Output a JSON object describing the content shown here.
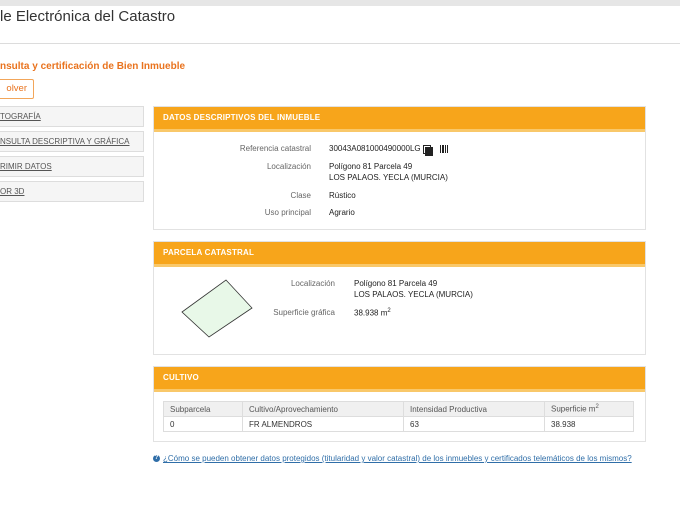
{
  "header": {
    "title": "le Electrónica del Catastro"
  },
  "page": {
    "subtitle": "nsulta y certificación de Bien Inmueble",
    "back_label": "olver"
  },
  "sidebar": {
    "items": [
      {
        "label": "TOGRAFÍA"
      },
      {
        "label": "NSULTA DESCRIPTIVA Y GRÁFICA"
      },
      {
        "label": "RIMIR DATOS"
      },
      {
        "label": "OR 3D"
      }
    ]
  },
  "datos": {
    "title": "DATOS DESCRIPTIVOS DEL INMUEBLE",
    "ref_label": "Referencia catastral",
    "ref_value": "30043A081000490000LG",
    "loc_label": "Localización",
    "loc_line1": "Polígono 81 Parcela 49",
    "loc_line2": "LOS PALAOS. YECLA (MURCIA)",
    "clase_label": "Clase",
    "clase_value": "Rústico",
    "uso_label": "Uso principal",
    "uso_value": "Agrario"
  },
  "parcela": {
    "title": "PARCELA CATASTRAL",
    "loc_label": "Localización",
    "loc_line1": "Polígono 81 Parcela 49",
    "loc_line2": "LOS PALAOS. YECLA (MURCIA)",
    "sup_label": "Superficie gráfica",
    "sup_value": "38.938 m",
    "sup_exp": "2"
  },
  "cultivo": {
    "title": "CULTIVO",
    "headers": [
      "Subparcela",
      "Cultivo/Aprovechamiento",
      "Intensidad Productiva",
      "Superficie m"
    ],
    "header_exp": "2",
    "row": [
      "0",
      "FR ALMENDROS",
      "63",
      "38.938"
    ]
  },
  "footer": {
    "link": "¿Cómo se pueden obtener datos protegidos (titularidad y valor catastral) de los inmuebles y certificados telemáticos de los mismos?"
  },
  "colors": {
    "accent": "#f7a51b",
    "orange_text": "#e9731e",
    "link": "#2f6ea8",
    "parcel_fill": "#e8f8e8"
  },
  "icons": {
    "copy": "copy-icon",
    "barcode": "barcode-icon",
    "help": "help-icon"
  }
}
